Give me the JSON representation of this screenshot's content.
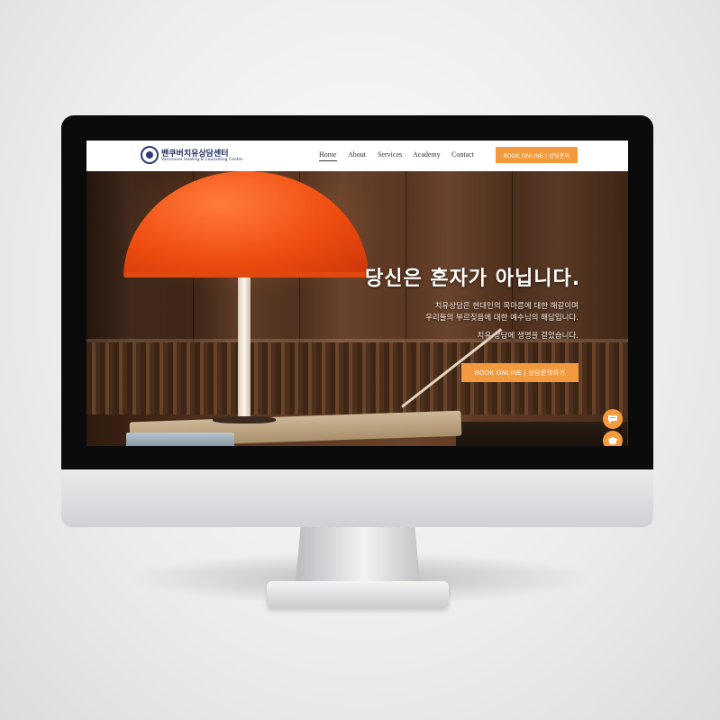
{
  "logo": {
    "name_ko": "밴쿠버치유상담센터",
    "name_en": "Vancouver Healing & Counseling Centre"
  },
  "nav": {
    "items": [
      {
        "label": "Home",
        "active": true
      },
      {
        "label": "About",
        "active": false
      },
      {
        "label": "Services",
        "active": false
      },
      {
        "label": "Academy",
        "active": false
      },
      {
        "label": "Contact",
        "active": false
      }
    ],
    "book_button": "BOOK ONLINE  |  상담문의"
  },
  "hero": {
    "title": "당신은 혼자가 아닙니다.",
    "line1": "치유상담은 현대인의 목마름에 대한 해갈이며",
    "line2": "우리들의 부르짖음에 대한 예수님의 해답입니다.",
    "line3": "치유 상담에 생명을 걸었습니다.",
    "button": "BOOK ONLINE  |  상담문의하기"
  },
  "floating": [
    "chat-icon",
    "graduation-cap-icon"
  ],
  "colors": {
    "accent": "#f39a3e",
    "brand": "#1f2a5e",
    "lamp": "#ef4d10"
  }
}
